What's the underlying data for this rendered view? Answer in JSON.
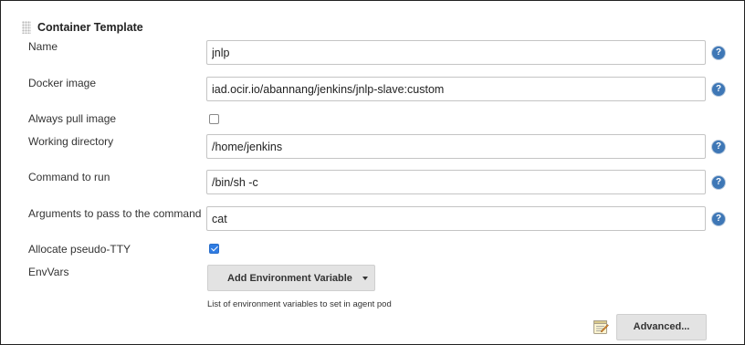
{
  "section": {
    "title": "Container Template"
  },
  "fields": {
    "name": {
      "label": "Name",
      "value": "jnlp"
    },
    "docker_image": {
      "label": "Docker image",
      "value": "iad.ocir.io/abannang/jenkins/jnlp-slave:custom"
    },
    "always_pull": {
      "label": "Always pull image",
      "checked": false
    },
    "working_dir": {
      "label": "Working directory",
      "value": "/home/jenkins"
    },
    "command": {
      "label": "Command to run",
      "value": "/bin/sh -c"
    },
    "args": {
      "label": "Arguments to pass to the command",
      "value": "cat"
    },
    "tty": {
      "label": "Allocate pseudo-TTY",
      "checked": true
    },
    "env_vars": {
      "label": "EnvVars",
      "button_label": "Add Environment Variable",
      "hint": "List of environment variables to set in agent pod"
    }
  },
  "help_glyph": "?",
  "buttons": {
    "advanced": "Advanced..."
  },
  "icons": {
    "help": "question-mark-circle-icon",
    "grip": "drag-handle-icon",
    "notepad": "notepad-icon",
    "dropdown": "chevron-down-icon"
  },
  "colors": {
    "help_icon": "#3e77b6",
    "checkbox_checked": "#2f7ce3",
    "button_bg": "#e3e3e3",
    "border": "#c4c4c4"
  }
}
